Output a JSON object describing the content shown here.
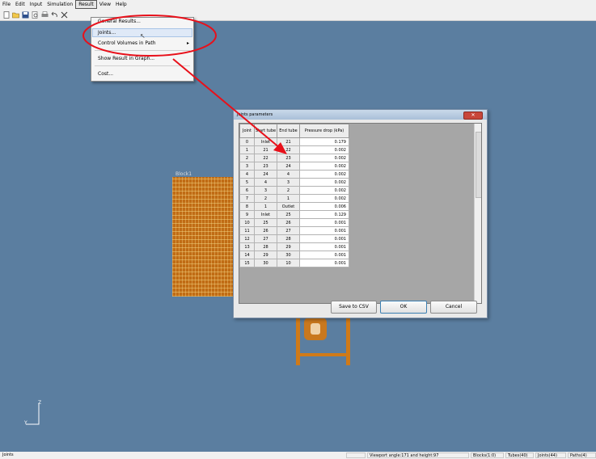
{
  "menu": [
    "File",
    "Edit",
    "Input",
    "Simulation",
    "Result",
    "View",
    "Help"
  ],
  "result_menu": {
    "items": [
      "General Results...",
      "Joints...",
      "Control Volumes in Path",
      "Show Result in Graph...",
      "Cost..."
    ],
    "submenu_arrow": "▸"
  },
  "toolbar": [
    "new-file-icon",
    "open-folder-icon",
    "save-icon",
    "print-preview-icon",
    "print-icon",
    "undo-icon",
    "delete-icon"
  ],
  "viewport": {
    "block_label": "Block1",
    "axis_z": "Z",
    "axis_y": "Y"
  },
  "dialog": {
    "title": "Joints parameters",
    "close_glyph": "✕",
    "columns": [
      "Joint",
      "Start tube",
      "End tube",
      "Pressure drop (kPa)"
    ],
    "rows": [
      [
        "0",
        "Inlet",
        "21",
        "0.179"
      ],
      [
        "1",
        "21",
        "22",
        "0.002"
      ],
      [
        "2",
        "22",
        "23",
        "0.002"
      ],
      [
        "3",
        "23",
        "24",
        "0.002"
      ],
      [
        "4",
        "24",
        "4",
        "0.002"
      ],
      [
        "5",
        "4",
        "3",
        "0.002"
      ],
      [
        "6",
        "3",
        "2",
        "0.002"
      ],
      [
        "7",
        "2",
        "1",
        "0.002"
      ],
      [
        "8",
        "1",
        "Outlet",
        "0.006"
      ],
      [
        "9",
        "Inlet",
        "25",
        "0.129"
      ],
      [
        "10",
        "25",
        "26",
        "0.001"
      ],
      [
        "11",
        "26",
        "27",
        "0.001"
      ],
      [
        "12",
        "27",
        "28",
        "0.001"
      ],
      [
        "13",
        "28",
        "29",
        "0.001"
      ],
      [
        "14",
        "29",
        "30",
        "0.001"
      ],
      [
        "15",
        "30",
        "10",
        "0.001"
      ]
    ],
    "buttons": {
      "save": "Save to CSV",
      "ok": "OK",
      "cancel": "Cancel"
    }
  },
  "status": {
    "left": "Joints",
    "viewport": "Viewport angle:171 and height:97",
    "blocks": "Blocks(1:0)",
    "tubes": "Tubes(40)",
    "joints": "Joints(44)",
    "paths": "Paths(4)"
  },
  "colors": {
    "viewport_bg": "#5b7ea0",
    "annotation": "#e8101a",
    "tube": "#c06c14"
  }
}
